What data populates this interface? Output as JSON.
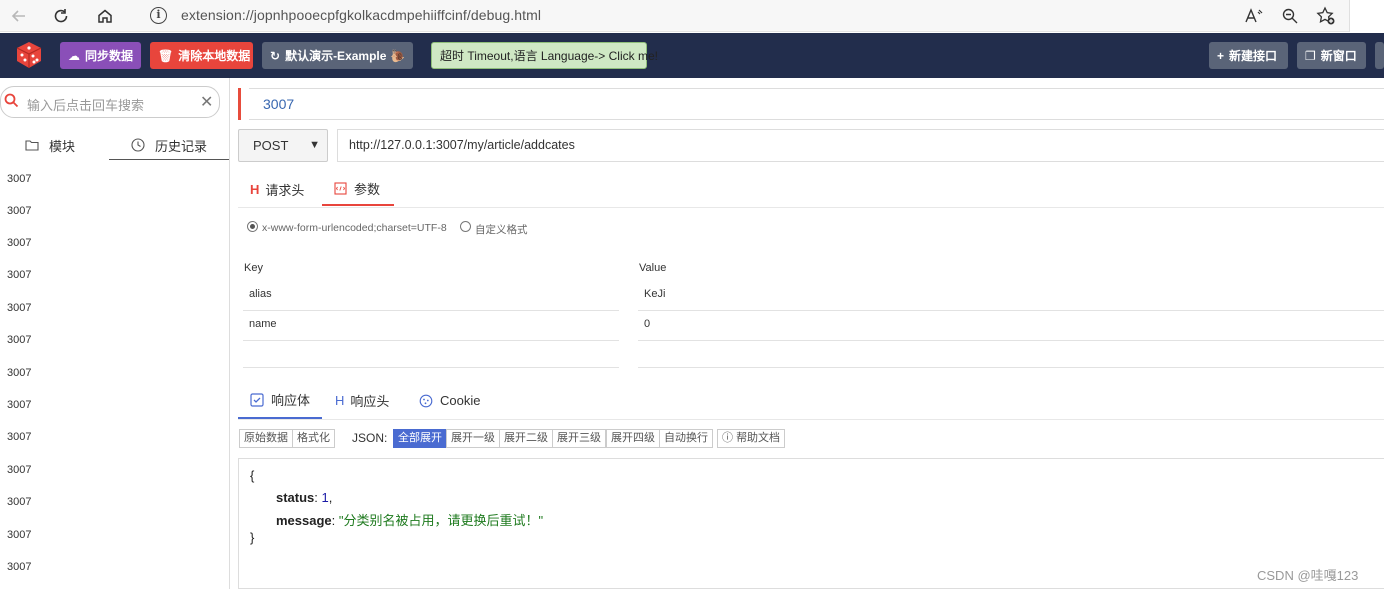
{
  "browser": {
    "url": "extension://jopnhpooecpfgkolkacdmpehiiffcinf/debug.html",
    "info_icon": "i"
  },
  "header": {
    "sync_label": "同步数据",
    "clear_label": "清除本地数据",
    "demo_label": "默认演示-Example",
    "timeout_label": "超时 Timeout,语言 Language-> Click me!",
    "new_api_label": "新建接口",
    "new_window_label": "新窗口",
    "colors": {
      "bg": "#222d4c",
      "sync": "#8a4fb8",
      "clear": "#e8453c",
      "demo": "#5a6478",
      "timeout": "#cfe8c4"
    }
  },
  "sidebar": {
    "search_placeholder": "输入后点击回车搜索",
    "tabs": [
      {
        "label": "模块",
        "icon": "folder-icon"
      },
      {
        "label": "历史记录",
        "icon": "clock-icon"
      }
    ],
    "history": [
      "3007",
      "3007",
      "3007",
      "3007",
      "3007",
      "3007",
      "3007",
      "3007",
      "3007",
      "3007",
      "3007",
      "3007",
      "3007"
    ]
  },
  "request": {
    "name": "3007",
    "method": "POST",
    "url": "http://127.0.0.1:3007/my/article/addcates",
    "tabs": [
      {
        "label": "请求头",
        "icon": "H"
      },
      {
        "label": "参数",
        "icon": "params-icon"
      }
    ],
    "formats": [
      "x-www-form-urlencoded;charset=UTF-8",
      "自定义格式"
    ],
    "params_headers": {
      "key": "Key",
      "value": "Value"
    },
    "params": [
      {
        "key": "alias",
        "value": "KeJi"
      },
      {
        "key": "name",
        "value": "0"
      }
    ]
  },
  "response": {
    "tabs": [
      {
        "label": "响应体",
        "icon": "check-icon"
      },
      {
        "label": "响应头",
        "icon": "H"
      },
      {
        "label": "Cookie",
        "icon": "cookie-icon"
      }
    ],
    "view_buttons": [
      "原始数据",
      "格式化"
    ],
    "json_label": "JSON:",
    "expand_buttons": [
      "全部展开",
      "展开一级",
      "展开二级",
      "展开三级",
      "展开四级",
      "自动换行"
    ],
    "help_label": "帮助文档",
    "body": {
      "open": "{",
      "close": "}",
      "status_key": "status",
      "status_value": "1",
      "message_key": "message",
      "message_value": "\"分类别名被占用，请更换后重试！\""
    }
  },
  "watermark": "CSDN @哇嘎123"
}
